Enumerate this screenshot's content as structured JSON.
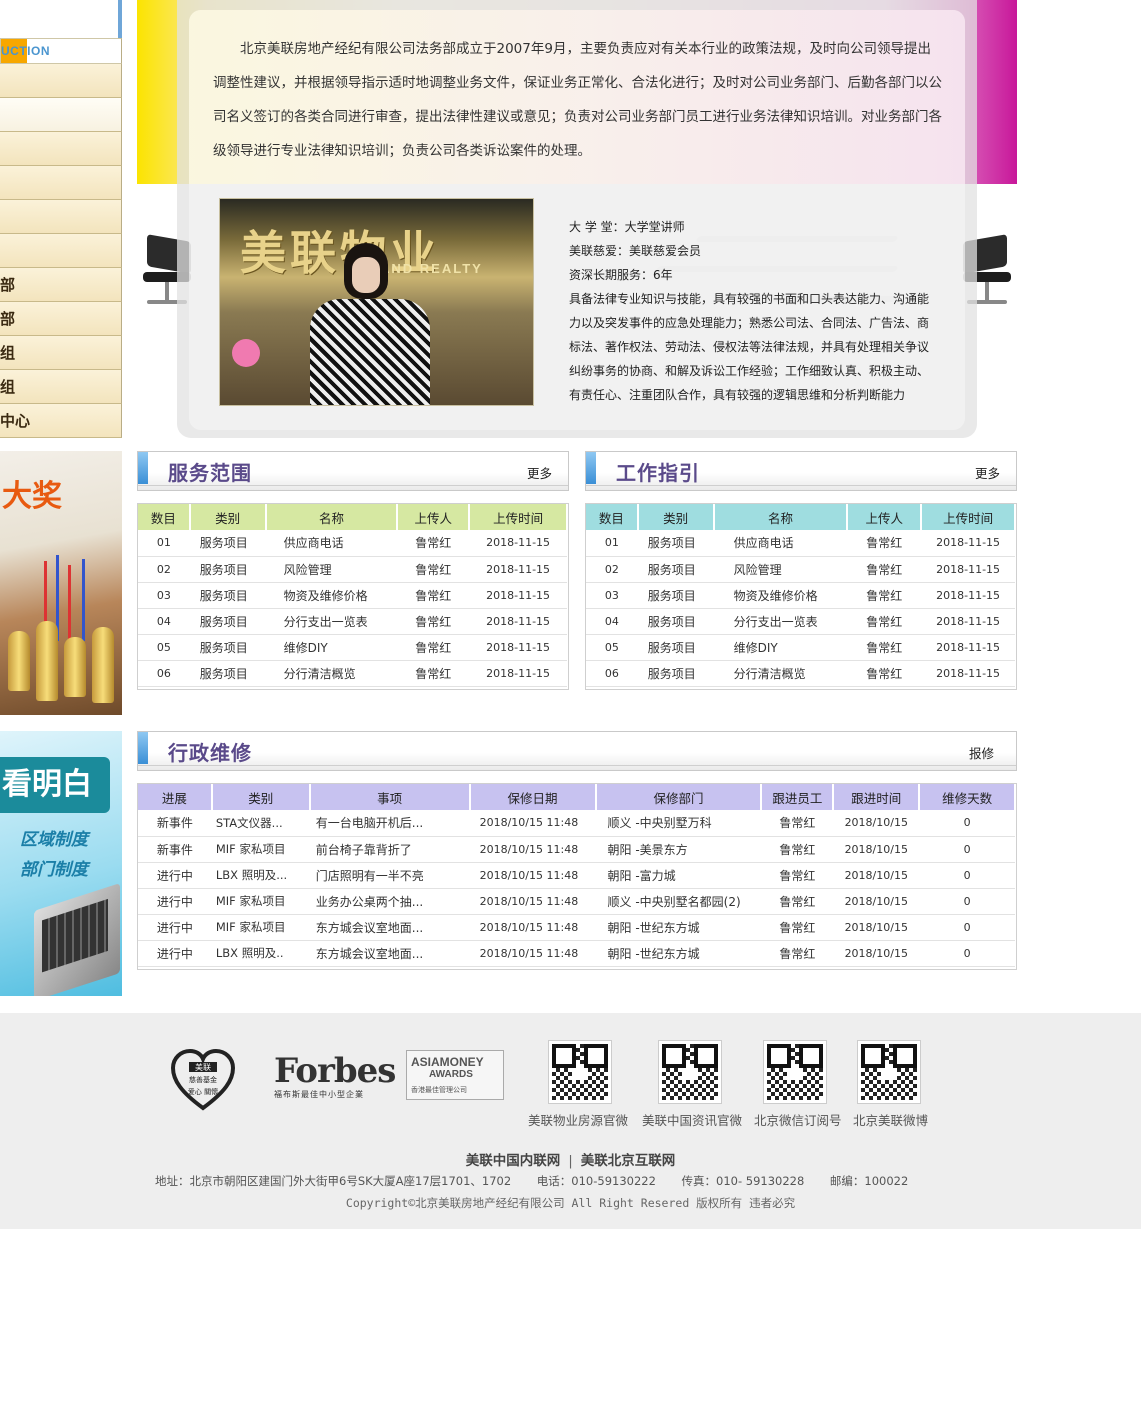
{
  "sidebar": {
    "intro_label": "UCTION",
    "items": [
      "",
      "",
      "",
      "",
      "",
      "",
      "部",
      "部",
      "组",
      "组",
      "中心"
    ],
    "banner_trophy_text": "大奖",
    "banner_book": {
      "head": "看明白",
      "line1": "区域制度",
      "line2": "部门制度"
    }
  },
  "intro": {
    "text": "北京美联房地产经纪有限公司法务部成立于2007年9月，主要负责应对有关本行业的政策法规，及时向公司领导提出调整性建议，并根据领导指示适时地调整业务文件，保证业务正常化、合法化进行；及时对公司业务部门、后勤各部门以公司名义签订的各类合同进行审查，提出法律性建议或意见；负责对公司业务部门员工进行业务法律知识培训。对业务部门各级领导进行专业法律知识培训；负责公司各类诉讼案件的处理。"
  },
  "photo": {
    "sign": "美联物业",
    "sign_en": "AND REALTY"
  },
  "profile": [
    "大 学 堂：大学堂讲师",
    "美联慈爱：美联慈爱会员",
    "资深长期服务：6年",
    "具备法律专业知识与技能，具有较强的书面和口头表达能力、沟通能力以及突发事件的应急处理能力；熟悉公司法、合同法、广告法、商标法、著作权法、劳动法、侵权法等法律法规，并具有处理相关争议纠纷事务的协商、和解及诉讼工作经验；工作细致认真、积极主动、有责任心、注重团队合作，具有较强的逻辑思维和分析判断能力"
  ],
  "service": {
    "title": "服务范围",
    "more": "更多",
    "columns": [
      "数目",
      "类别",
      "名称",
      "上传人",
      "上传时间"
    ],
    "rows": [
      [
        "01",
        "服务项目",
        "供应商电话",
        "鲁常红",
        "2018-11-15"
      ],
      [
        "02",
        "服务项目",
        "风险管理",
        "鲁常红",
        "2018-11-15"
      ],
      [
        "03",
        "服务项目",
        "物资及维修价格",
        "鲁常红",
        "2018-11-15"
      ],
      [
        "04",
        "服务项目",
        "分行支出一览表",
        "鲁常红",
        "2018-11-15"
      ],
      [
        "05",
        "服务项目",
        "维修DIY",
        "鲁常红",
        "2018-11-15"
      ],
      [
        "06",
        "服务项目",
        "分行清洁概览",
        "鲁常红",
        "2018-11-15"
      ]
    ]
  },
  "guide": {
    "title": "工作指引",
    "more": "更多",
    "columns": [
      "数目",
      "类别",
      "名称",
      "上传人",
      "上传时间"
    ],
    "rows": [
      [
        "01",
        "服务项目",
        "供应商电话",
        "鲁常红",
        "2018-11-15"
      ],
      [
        "02",
        "服务项目",
        "风险管理",
        "鲁常红",
        "2018-11-15"
      ],
      [
        "03",
        "服务项目",
        "物资及维修价格",
        "鲁常红",
        "2018-11-15"
      ],
      [
        "04",
        "服务项目",
        "分行支出一览表",
        "鲁常红",
        "2018-11-15"
      ],
      [
        "05",
        "服务项目",
        "维修DIY",
        "鲁常红",
        "2018-11-15"
      ],
      [
        "06",
        "服务项目",
        "分行清洁概览",
        "鲁常红",
        "2018-11-15"
      ]
    ]
  },
  "maintenance": {
    "title": "行政维修",
    "more": "报修",
    "columns": [
      "进展",
      "类别",
      "事项",
      "保修日期",
      "保修部门",
      "跟进员工",
      "跟进时间",
      "维修天数"
    ],
    "rows": [
      [
        "新事件",
        "STA文仪器...",
        "有一台电脑开机后...",
        "2018/10/15  11:48",
        "顺义 -中央别墅万科",
        "鲁常红",
        "2018/10/15",
        "0"
      ],
      [
        "新事件",
        "MIF 家私项目",
        "前台椅子靠背折了",
        "2018/10/15  11:48",
        "朝阳 -美景东方",
        "鲁常红",
        "2018/10/15",
        "0"
      ],
      [
        "进行中",
        "LBX 照明及...",
        "门店照明有一半不亮",
        "2018/10/15  11:48",
        "朝阳 -富力城",
        "鲁常红",
        "2018/10/15",
        "0"
      ],
      [
        "进行中",
        "MIF 家私项目",
        "业务办公桌两个抽...",
        "2018/10/15  11:48",
        "顺义 -中央别墅名都园(2)",
        "鲁常红",
        "2018/10/15",
        "0"
      ],
      [
        "进行中",
        "MIF 家私项目",
        "东方城会议室地面...",
        "2018/10/15  11:48",
        "朝阳 -世纪东方城",
        "鲁常红",
        "2018/10/15",
        "0"
      ],
      [
        "进行中",
        "LBX 照明及..",
        "东方城会议室地面...",
        "2018/10/15  11:48",
        "朝阳 -世纪东方城",
        "鲁常红",
        "2018/10/15",
        "0"
      ]
    ]
  },
  "footer": {
    "charity_top": "美联",
    "charity_sub": "慈善基金",
    "charity_bottom": "爱心 關懷",
    "forbes": "Forbes",
    "forbes_sub": "福布斯最佳中小型企業",
    "asia_1": "ASIAMONEY",
    "asia_2": "AWARDS",
    "asia_3": "香港最佳管理公司",
    "qr_labels": [
      "美联物业房源官微",
      "美联中国资讯官微",
      "北京微信订阅号",
      "北京美联微博"
    ],
    "links": [
      "美联中国内联网",
      "美联北京互联网"
    ],
    "link_sep": "|",
    "address": "地址：北京市朝阳区建国门外大街甲6号SK大厦A座17层1701、1702       电话：010-59130222       传真：010- 59130228       邮编：100022",
    "copyright": "Copyright©北京美联房地产经纪有限公司 All Right Resered 版权所有 违者必究"
  }
}
